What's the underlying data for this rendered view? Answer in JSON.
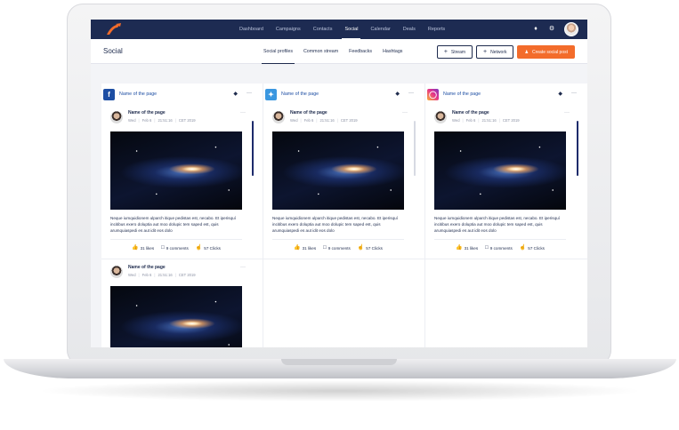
{
  "nav": {
    "links": [
      "Dashboard",
      "Campaigns",
      "Contacts",
      "Social",
      "Calendar",
      "Deals",
      "Reports"
    ],
    "active": "Social"
  },
  "header": {
    "title": "Social",
    "tabs": [
      "Social profiles",
      "Common stream",
      "Feedbacks",
      "Hashtags"
    ],
    "stream_button": "Stream",
    "network_button": "Network",
    "create_button": "Create social post"
  },
  "columns": [
    {
      "network": "facebook",
      "name": "Name of the page"
    },
    {
      "network": "twitter",
      "name": "Name of the page"
    },
    {
      "network": "instagram",
      "name": "Name of the page"
    }
  ],
  "post": {
    "author": "Name of the page",
    "meta": [
      "Wed",
      "Feb 6",
      "21:51:16",
      "CET 2019"
    ],
    "text": "Neque iumquidionem ulparch itique pedistas est, necabo. Et iperisquí incitibus exero doluptia aut moo dolupic tem saped est, quis arumquiaspedi es aut idit eos dolo",
    "likes": "31 likes",
    "comments": "9 comments",
    "clicks": "57 Clicks"
  },
  "colors": {
    "navy": "#1d2b52",
    "accent": "#f36c2b",
    "facebook": "#1d4ea3",
    "twitter": "#3a97e0"
  }
}
